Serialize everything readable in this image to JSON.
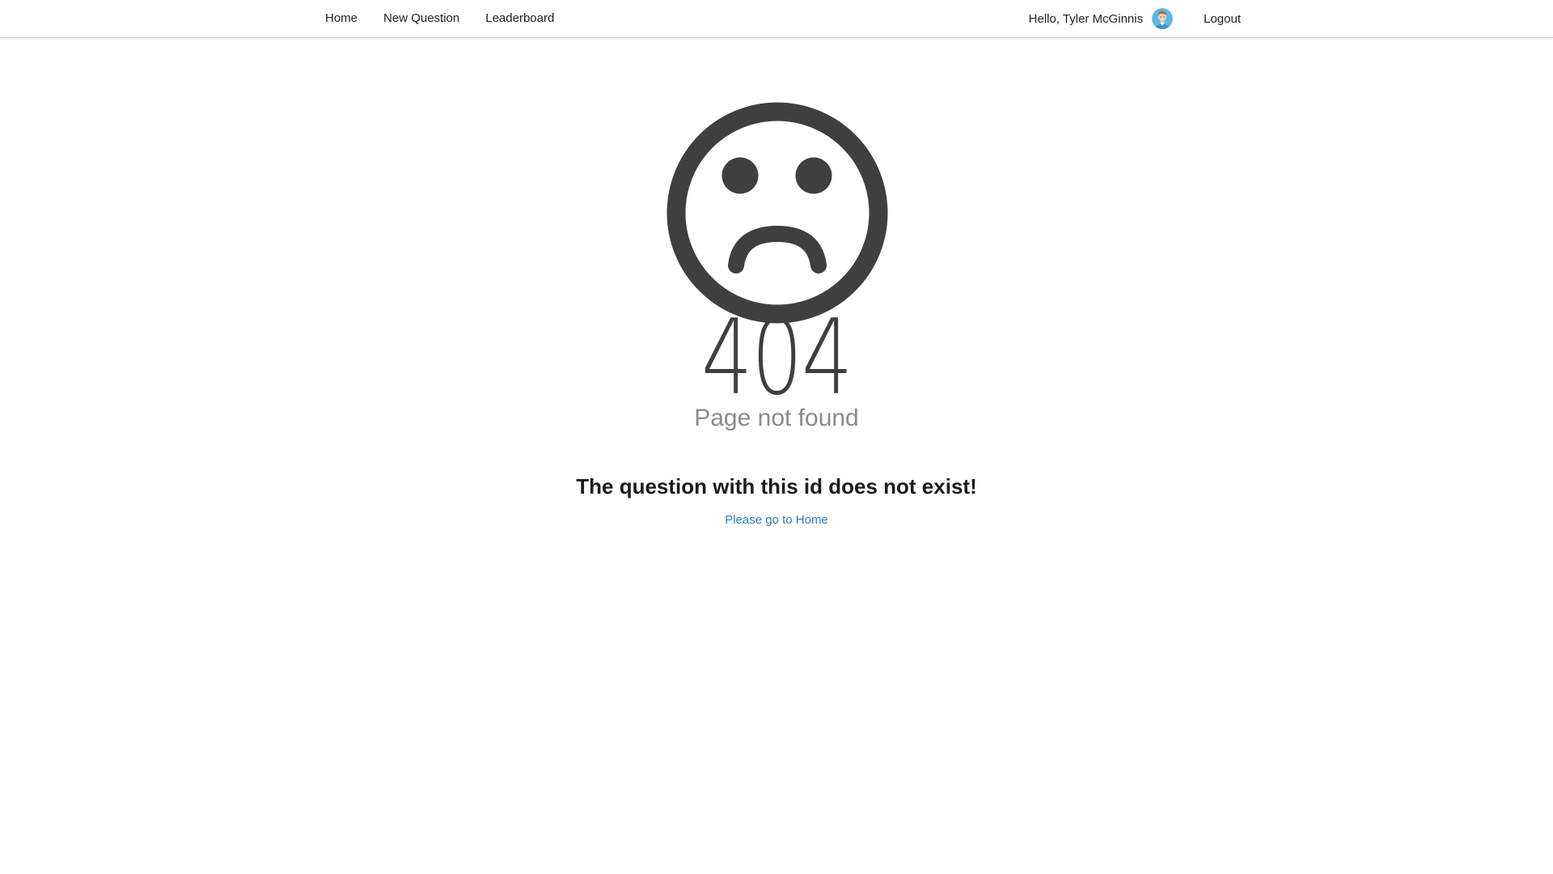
{
  "nav": {
    "items": [
      {
        "label": "Home"
      },
      {
        "label": "New Question"
      },
      {
        "label": "Leaderboard"
      }
    ],
    "greeting": "Hello, Tyler McGinnis",
    "logout_label": "Logout"
  },
  "error": {
    "icon": "sad-face-icon",
    "code": "404",
    "subtitle": "Page not found",
    "message": "The question with this id does not exist!",
    "link_label": "Please go to Home"
  },
  "colors": {
    "icon": "#3f3f3f",
    "link": "#2b7dc5",
    "subtitle": "#8a8a8a"
  }
}
